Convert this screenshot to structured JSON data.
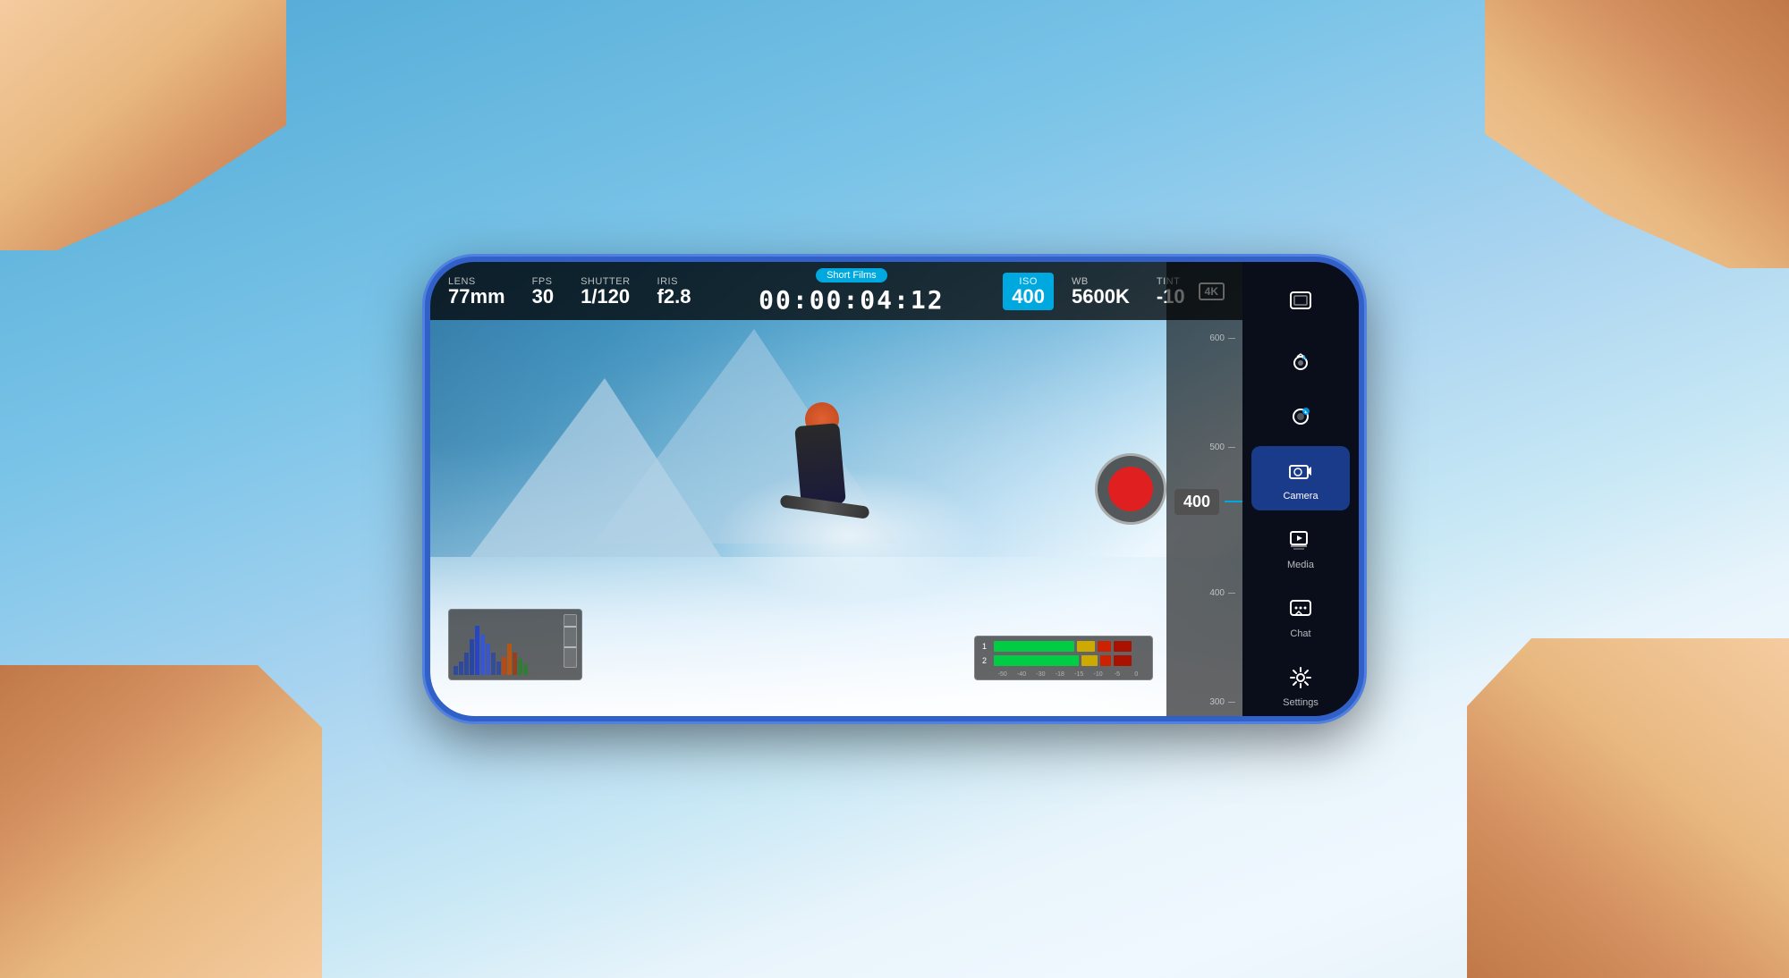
{
  "background": {
    "color_top": "#4da8d4",
    "color_bottom": "#87c8e8"
  },
  "hud": {
    "lens_label": "LENS",
    "lens_value": "77mm",
    "fps_label": "FPS",
    "fps_value": "30",
    "shutter_label": "SHUTTER",
    "shutter_value": "1/120",
    "iris_label": "IRIS",
    "iris_value": "f2.8",
    "project_name": "Short Films",
    "timecode": "00:00:04:12",
    "iso_label": "ISO",
    "iso_value": "400",
    "wb_label": "WB",
    "wb_value": "5600K",
    "tint_label": "TINT",
    "tint_value": "-10",
    "resolution": "4K"
  },
  "exposure": {
    "value": "400",
    "ticks": [
      "600",
      "500",
      "400",
      "300"
    ]
  },
  "nav": {
    "top_icon": "frame-icon",
    "items": [
      {
        "id": "auto",
        "label": "",
        "icon": "auto-camera-icon",
        "active": false
      },
      {
        "id": "effect",
        "label": "",
        "icon": "effect-icon",
        "active": false
      },
      {
        "id": "camera",
        "label": "Camera",
        "icon": "camera-icon",
        "active": true
      },
      {
        "id": "media",
        "label": "Media",
        "icon": "media-icon",
        "active": false
      },
      {
        "id": "chat",
        "label": "Chat",
        "icon": "chat-icon",
        "active": false
      },
      {
        "id": "settings",
        "label": "Settings",
        "icon": "settings-icon",
        "active": false
      },
      {
        "id": "list",
        "label": "",
        "icon": "list-icon",
        "active": false
      }
    ]
  },
  "audio": {
    "track1_num": "1",
    "track2_num": "2",
    "scale_labels": [
      "-50",
      "-40",
      "-30",
      "-18",
      "-15",
      "-10",
      "-5",
      "0"
    ]
  }
}
